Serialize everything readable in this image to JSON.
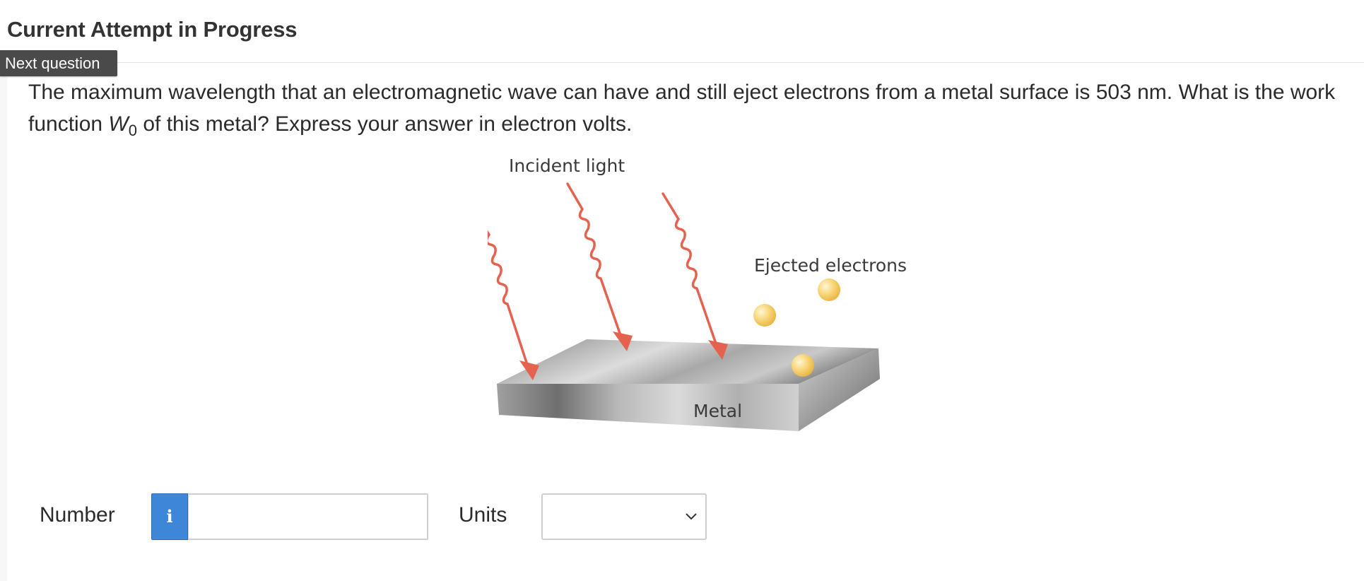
{
  "header": {
    "title": "Current Attempt in Progress",
    "next_question_label": "Next question"
  },
  "question": {
    "text_part1": "The maximum wavelength that an electromagnetic wave can have and still eject electrons from a metal surface is 503 nm. What is the work function ",
    "symbol": "W",
    "subscript": "0",
    "text_part2": " of this metal? Express your answer in electron volts."
  },
  "figure": {
    "incident_label": "Incident light",
    "ejected_label": "Ejected electrons",
    "metal_label": "Metal",
    "colors": {
      "wave": "#e5624f",
      "electron": "#f6c65a",
      "metal_top": "#b9b9b9",
      "metal_front": "#9a9a9a"
    }
  },
  "answer": {
    "number_label": "Number",
    "info_icon": "info-icon",
    "info_glyph": "i",
    "number_value": "",
    "units_label": "Units",
    "units_selected": "",
    "accent": "#3d86d8"
  }
}
